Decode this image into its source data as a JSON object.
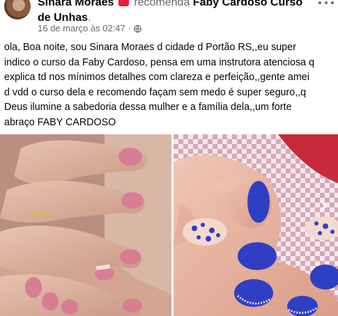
{
  "post": {
    "author_name": "Sinara Moraes",
    "recommends_text": "recomenda",
    "page_name": "Faby Cardoso Curso de Unhas",
    "page_name_suffix": ".",
    "timestamp": "16 de março às 02:47",
    "separator": "·",
    "audience_icon": "globe-icon",
    "more_icon": "more-horizontal-icon",
    "badge_icon": "recommend-heart-icon",
    "text": "ola, Boa noite, sou Sinara Moraes d cidade d Portão RS,,eu super\nindico o curso da Faby Cardoso, pensa em uma instrutora atenciosa q\nexplica td nos mínimos detalhes com clareza e perfeição,,gente amei\nd vdd o curso dela e recomendo façam sem medo é super seguro,,q\nDeus ilumine a sabedoria dessa mulher e a família dela,,um forte\nabraço FABY CARDOSO"
  },
  "photos": [
    {
      "id": "photo-pink-nails",
      "nail_color": "#d97d94"
    },
    {
      "id": "photo-blue-nails",
      "nail_color": "#2f3fc4"
    }
  ],
  "colors": {
    "secondary_text": "#65676b",
    "recommend_badge": "#e41e3f",
    "text": "#050505"
  }
}
